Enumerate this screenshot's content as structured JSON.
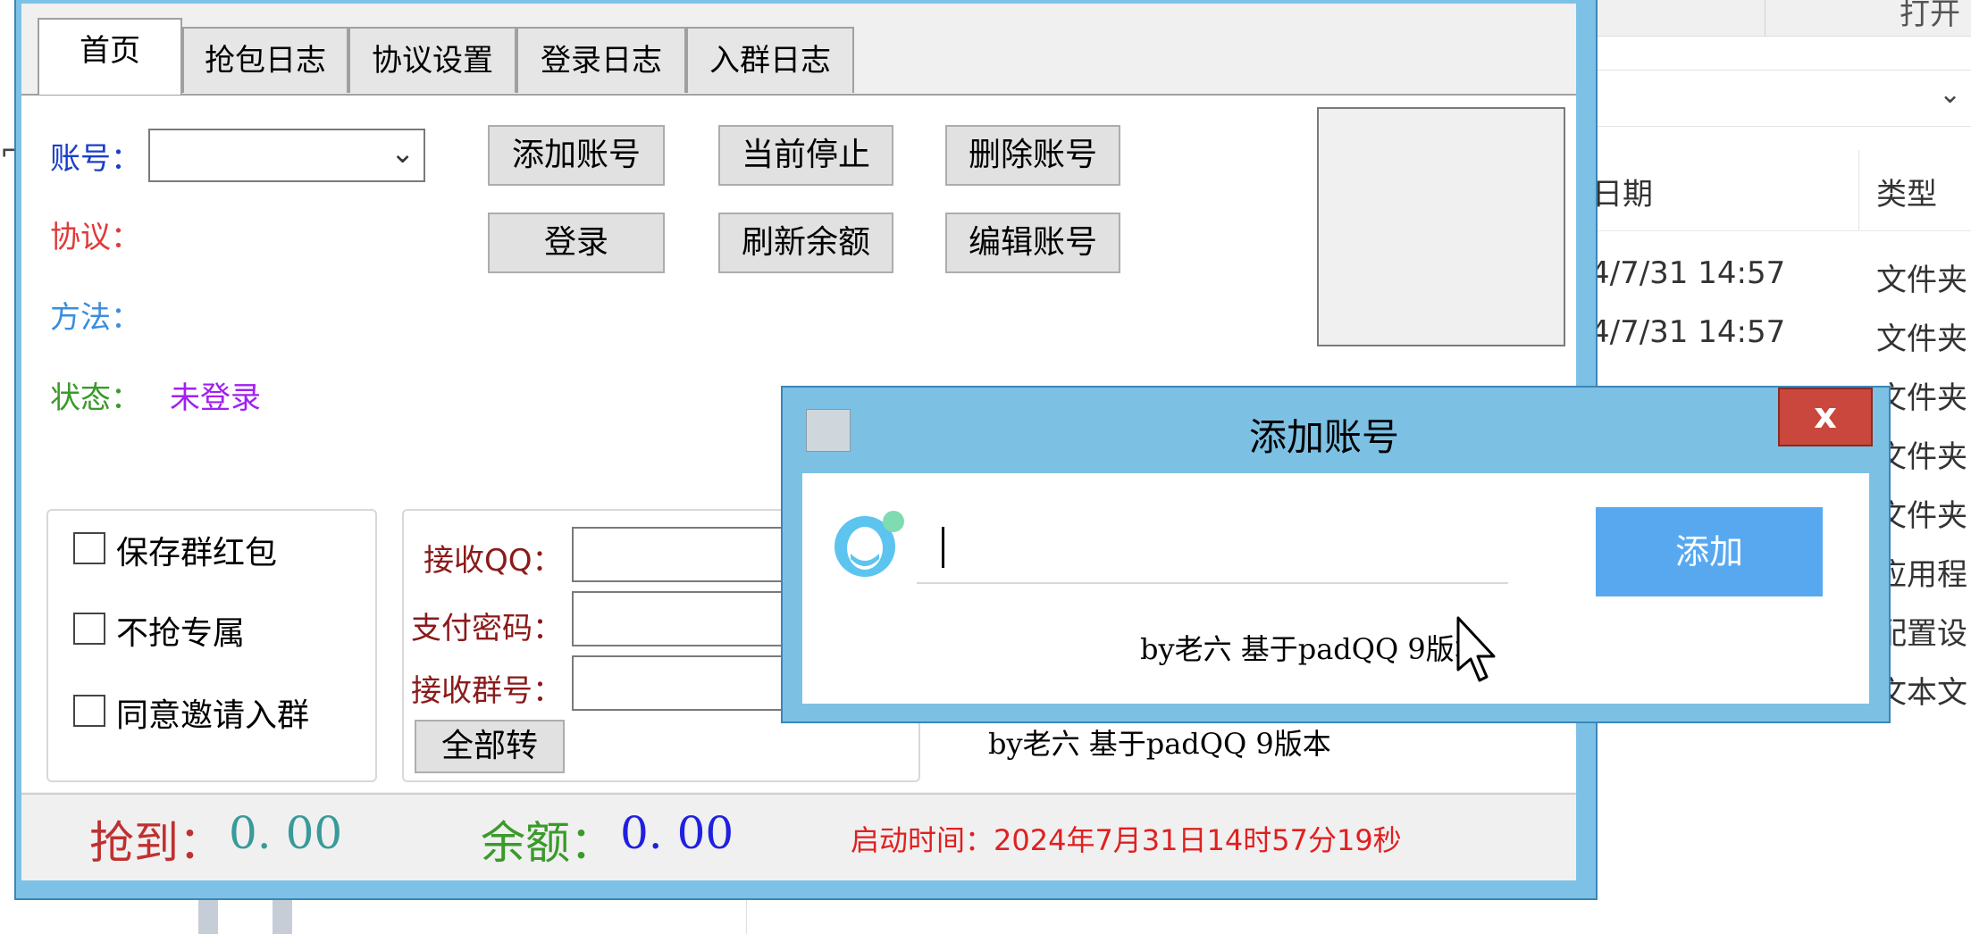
{
  "main_window": {
    "tabs": [
      {
        "label": "首页",
        "active": true
      },
      {
        "label": "抢包日志",
        "active": false
      },
      {
        "label": "协议设置",
        "active": false
      },
      {
        "label": "登录日志",
        "active": false
      },
      {
        "label": "入群日志",
        "active": false
      }
    ],
    "fields": {
      "account_label": "账号：",
      "account_value": "",
      "protocol_label": "协议：",
      "method_label": "方法：",
      "status_label": "状态：",
      "status_value": "未登录"
    },
    "buttons": {
      "add_account": "添加账号",
      "stop_current": "当前停止",
      "delete_account": "删除账号",
      "login": "登录",
      "refresh_balance": "刷新余额",
      "edit_account": "编辑账号",
      "transfer_all": "全部转"
    },
    "options": [
      {
        "label": "保存群红包",
        "checked": false
      },
      {
        "label": "不抢专属",
        "checked": false
      },
      {
        "label": "同意邀请入群",
        "checked": false
      }
    ],
    "transfer": {
      "receive_qq_label": "接收QQ：",
      "receive_qq_value": "",
      "pay_password_label": "支付密码：",
      "pay_password_value": "",
      "receive_group_label": "接收群号：",
      "receive_group_value": ""
    },
    "credit": "by老六 基于padQQ 9版本",
    "status_bar": {
      "grabbed_label": "抢到：",
      "grabbed_value": "0. 00",
      "balance_label": "余额：",
      "balance_value": "0. 00",
      "start_time": "启动时间：2024年7月31日14时57分19秒"
    }
  },
  "dialog": {
    "title": "添加账号",
    "close_label": "x",
    "input_value": "",
    "add_button": "添加",
    "credit": "by老六 基于padQQ 9版本"
  },
  "background_explorer": {
    "top_button": "打开",
    "col_date": "日期",
    "col_type": "类型",
    "rows": [
      {
        "date": "4/7/31 14:57",
        "type": "文件夹"
      },
      {
        "date": "4/7/31 14:57",
        "type": "文件夹"
      },
      {
        "date": "",
        "type": "文件夹"
      },
      {
        "date": "",
        "type": "文件夹"
      },
      {
        "date": "",
        "type": "文件夹"
      },
      {
        "date": "",
        "type": "应用程"
      },
      {
        "date": "",
        "type": "配置设"
      },
      {
        "date": "",
        "type": "文本文"
      }
    ]
  },
  "colors": {
    "window_frame": "#7dc2e6",
    "protocol_label": "#e03a3a",
    "method_label": "#3a8de0",
    "status_label": "#3a9a2a",
    "status_value": "#a020f0",
    "grabbed_label": "#c03030",
    "grabbed_value": "#3a9a9a",
    "balance_label": "#3a9a2a",
    "balance_value": "#2020e0",
    "start_time": "#e02020",
    "dialog_add_button": "#57a8ef"
  }
}
